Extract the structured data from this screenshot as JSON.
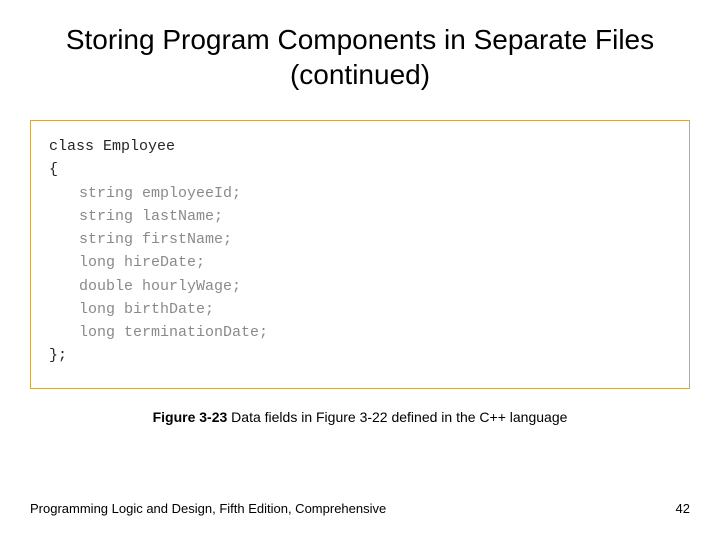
{
  "title": "Storing Program Components in Separate Files (continued)",
  "code": {
    "line1": "class Employee",
    "line2": "{",
    "fields": [
      "string employeeId;",
      "string lastName;",
      "string firstName;",
      "long hireDate;",
      "double hourlyWage;",
      "long birthDate;",
      "long terminationDate;"
    ],
    "close": "};"
  },
  "caption_lead": "Figure 3-23",
  "caption_rest": "  Data fields in Figure 3-22 defined in the C++ language",
  "footer_left": "Programming Logic and Design, Fifth Edition, Comprehensive",
  "footer_right": "42"
}
